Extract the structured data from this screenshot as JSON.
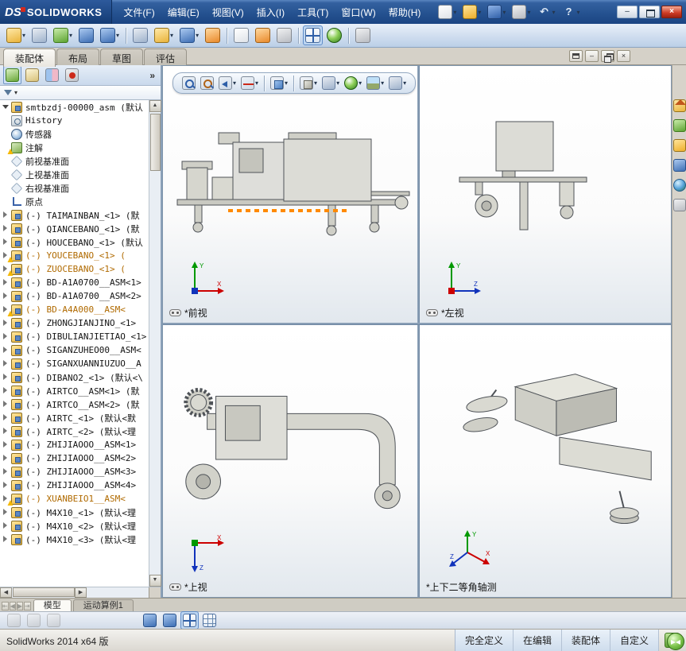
{
  "icons": {
    "caret": "▾",
    "chevrons": "»",
    "minimize": "–",
    "close": "×",
    "up": "▲",
    "down": "▼",
    "left": "◀",
    "right": "▶"
  },
  "titlebar": {
    "logo_mark": "DS",
    "logo_text": "SOLIDWORKS",
    "menus": [
      {
        "name": "menu-file",
        "label": "文件(F)"
      },
      {
        "name": "menu-edit",
        "label": "编辑(E)"
      },
      {
        "name": "menu-view",
        "label": "视图(V)"
      },
      {
        "name": "menu-insert",
        "label": "插入(I)"
      },
      {
        "name": "menu-tools",
        "label": "工具(T)"
      },
      {
        "name": "menu-window",
        "label": "窗口(W)"
      },
      {
        "name": "menu-help",
        "label": "帮助(H)"
      }
    ],
    "tools": [
      {
        "name": "new-document-icon",
        "style": "s-page",
        "caret": true
      },
      {
        "name": "open-icon",
        "style": "s-folder",
        "caret": true
      },
      {
        "name": "save-icon",
        "style": "s-save",
        "caret": true
      },
      {
        "name": "print-icon",
        "style": "s-gray",
        "caret": true
      },
      {
        "name": "undo-icon",
        "style": "s-glyph",
        "glyph": "↶",
        "caret": true
      },
      {
        "name": "help-icon",
        "style": "s-glyph",
        "glyph": "?",
        "caret": true
      }
    ]
  },
  "toolbar2": [
    {
      "name": "insert-components-icon",
      "style": "s-yellow",
      "caret": true
    },
    {
      "name": "mate-icon",
      "style": "s-clip"
    },
    {
      "name": "linear-component-pattern-icon",
      "style": "s-green",
      "caret": true
    },
    {
      "name": "smart-fasteners-icon",
      "style": "s-bolt"
    },
    {
      "name": "move-component-icon",
      "style": "s-blue",
      "caret": true
    },
    {
      "sep": true
    },
    {
      "name": "show-hidden-components-icon",
      "style": "s-eye"
    },
    {
      "name": "assembly-features-icon",
      "style": "s-yellow2",
      "caret": true
    },
    {
      "name": "reference-geometry-icon",
      "style": "s-refgeo",
      "caret": true
    },
    {
      "name": "new-motion-study-icon",
      "style": "s-motion"
    },
    {
      "sep": true
    },
    {
      "name": "bill-of-materials-icon",
      "style": "s-bom"
    },
    {
      "name": "exploded-view-icon",
      "style": "s-explode"
    },
    {
      "name": "instant3d-icon",
      "style": "s-gray2"
    },
    {
      "sep": true
    },
    {
      "name": "viewport-layout-icon",
      "style": "s-viewports",
      "active": true
    },
    {
      "name": "performance-evaluation-icon",
      "style": "s-greenball"
    },
    {
      "sep": true
    },
    {
      "name": "options-icon",
      "style": "s-task"
    }
  ],
  "command_tabs": [
    {
      "name": "tab-assembly",
      "label": "装配体",
      "active": true
    },
    {
      "name": "tab-layout",
      "label": "布局",
      "active": false
    },
    {
      "name": "tab-sketch",
      "label": "草图",
      "active": false
    },
    {
      "name": "tab-evaluate",
      "label": "评估",
      "active": false
    }
  ],
  "left_panel": {
    "tabs": [
      {
        "name": "featuremanager-tab-icon",
        "style": "s-tree",
        "active": true
      },
      {
        "name": "propertymanager-tab-icon",
        "style": "s-props",
        "active": false
      },
      {
        "name": "configurationmanager-tab-icon",
        "style": "s-config",
        "active": false
      },
      {
        "name": "dimxpertmanager-tab-icon",
        "style": "s-dimx",
        "active": false
      }
    ]
  },
  "tree": {
    "root": "smtbzdj-00000_asm (默认",
    "items": [
      {
        "icon": "history",
        "label": "History"
      },
      {
        "icon": "sensor",
        "label": "传感器"
      },
      {
        "icon": "annotation",
        "warn": true,
        "label": "注解"
      },
      {
        "icon": "plane",
        "label": "前视基准面"
      },
      {
        "icon": "plane",
        "label": "上视基准面"
      },
      {
        "icon": "plane",
        "label": "右视基准面"
      },
      {
        "icon": "origin",
        "label": "原点"
      },
      {
        "icon": "assembly",
        "caret": true,
        "label": "(-) TAIMAINBAN_<1> (默"
      },
      {
        "icon": "assembly",
        "caret": true,
        "label": "(-) QIANCEBANO_<1> (默"
      },
      {
        "icon": "assembly",
        "caret": true,
        "label": "(-) HOUCEBANO_<1> (默认"
      },
      {
        "icon": "assembly",
        "caret": true,
        "warn": true,
        "orange": true,
        "label": "(-) YOUCEBANO_<1> ("
      },
      {
        "icon": "assembly",
        "caret": true,
        "warn": true,
        "orange": true,
        "label": "(-) ZUOCEBANO_<1> ("
      },
      {
        "icon": "assembly",
        "caret": true,
        "label": "(-) BD-A1A0700__ASM<1>"
      },
      {
        "icon": "assembly",
        "caret": true,
        "label": "(-) BD-A1A0700__ASM<2>"
      },
      {
        "icon": "assembly",
        "caret": true,
        "warn": true,
        "orange": true,
        "label": "(-) BD-A4A000__ASM<"
      },
      {
        "icon": "assembly",
        "caret": true,
        "label": "(-) ZHONGJIANJINO_<1>"
      },
      {
        "icon": "assembly",
        "caret": true,
        "label": "(-) DIBULIANJIETIAO_<1>"
      },
      {
        "icon": "assembly",
        "caret": true,
        "label": "(-) SIGANZUHEO00__ASM<"
      },
      {
        "icon": "assembly",
        "caret": true,
        "label": "(-) SIGANXUANNIUZUO__A"
      },
      {
        "icon": "assembly",
        "caret": true,
        "label": "(-) DIBANO2_<1> (默认<\\"
      },
      {
        "icon": "assembly",
        "caret": true,
        "label": "(-) AIRTCO__ASM<1> (默"
      },
      {
        "icon": "assembly",
        "caret": true,
        "label": "(-) AIRTCO__ASM<2> (默"
      },
      {
        "icon": "assembly",
        "caret": true,
        "label": "(-) AIRTC_<1> (默认<默"
      },
      {
        "icon": "assembly",
        "caret": true,
        "label": "(-) AIRTC_<2> (默认<理"
      },
      {
        "icon": "assembly",
        "caret": true,
        "label": "(-) ZHIJIAOOO__ASM<1>"
      },
      {
        "icon": "assembly",
        "caret": true,
        "label": "(-) ZHIJIAOOO__ASM<2>"
      },
      {
        "icon": "assembly",
        "caret": true,
        "label": "(-) ZHIJIAOOO__ASM<3>"
      },
      {
        "icon": "assembly",
        "caret": true,
        "label": "(-) ZHIJIAOOO__ASM<4>"
      },
      {
        "icon": "assembly",
        "caret": true,
        "warn": true,
        "orange": true,
        "label": "(-) XUANBEIO1__ASM<"
      },
      {
        "icon": "assembly",
        "caret": true,
        "label": "(-) M4X10_<1> (默认<理"
      },
      {
        "icon": "assembly",
        "caret": true,
        "label": "(-) M4X10_<2> (默认<理"
      },
      {
        "icon": "assembly",
        "caret": true,
        "label": "(-) M4X10_<3> (默认<理"
      }
    ]
  },
  "headsup": [
    {
      "name": "zoom-to-fit-icon",
      "style": "s-magnifier"
    },
    {
      "name": "zoom-to-area-icon",
      "style": "s-magnifier2"
    },
    {
      "name": "previous-view-icon",
      "style": "s-arrowprev",
      "caret": true
    },
    {
      "name": "section-view-icon",
      "style": "s-section",
      "caret": true
    },
    {
      "sep": true
    },
    {
      "name": "view-orientation-icon",
      "style": "s-cube",
      "caret": true
    },
    {
      "sep": true
    },
    {
      "name": "display-style-icon",
      "style": "s-cube2",
      "caret": true
    },
    {
      "name": "hide-show-items-icon",
      "style": "s-glasses",
      "caret": true
    },
    {
      "name": "edit-appearance-icon",
      "style": "s-sphere",
      "caret": true
    },
    {
      "name": "apply-scene-icon",
      "style": "s-scene",
      "caret": true
    },
    {
      "name": "view-settings-icon",
      "style": "s-eye2",
      "caret": true
    }
  ],
  "right_toolbar": [
    {
      "name": "task-pane-home-icon",
      "style": "s-house"
    },
    {
      "name": "design-library-icon",
      "style": "s-chart"
    },
    {
      "name": "file-explorer-icon",
      "style": "s-folder"
    },
    {
      "name": "toolbox-icon",
      "style": "s-toolbox"
    },
    {
      "name": "appearances-icon",
      "style": "s-globe"
    },
    {
      "name": "custom-properties-icon",
      "style": "s-pencil"
    }
  ],
  "viewports": [
    {
      "label": "*前视"
    },
    {
      "label": "*左视"
    },
    {
      "label": "*上视"
    },
    {
      "label": "*上下二等角轴测"
    }
  ],
  "axes": {
    "x": "X",
    "y": "Y",
    "z": "Z"
  },
  "bottom": {
    "nav": [
      {
        "name": "nav-first-button",
        "glyph": "⇤"
      },
      {
        "name": "nav-prev-button",
        "glyph": "◀"
      },
      {
        "name": "nav-next-button",
        "glyph": "▶"
      },
      {
        "name": "nav-last-button",
        "glyph": "⇥"
      }
    ],
    "tabs": [
      {
        "name": "tab-model",
        "label": "模型",
        "active": true
      },
      {
        "name": "tab-motion-study-1",
        "label": "运动算例1",
        "active": false
      }
    ],
    "tools": [
      {
        "name": "filter-tree-icon",
        "style": "s-gray",
        "disabled": true
      },
      {
        "name": "display-pane-icon",
        "style": "s-gray",
        "disabled": true
      },
      {
        "name": "hide-types-icon",
        "style": "s-gray",
        "disabled": true
      },
      {
        "spacer": true
      },
      {
        "name": "isolate-icon",
        "style": "s-blue"
      },
      {
        "name": "edit-component-icon",
        "style": "s-blue"
      },
      {
        "name": "large-assembly-mode-icon",
        "style": "s-viewports",
        "active": true
      },
      {
        "name": "grid-system-icon",
        "style": "s-grid"
      }
    ]
  },
  "statusbar": {
    "left": "SolidWorks 2014 x64 版",
    "cells": [
      {
        "name": "status-fully-defined",
        "label": "完全定义"
      },
      {
        "name": "status-editing",
        "label": "在编辑"
      },
      {
        "name": "status-editing-scope",
        "label": "装配体"
      },
      {
        "name": "status-customize",
        "label": "自定义"
      }
    ],
    "help_glyph": "?"
  }
}
